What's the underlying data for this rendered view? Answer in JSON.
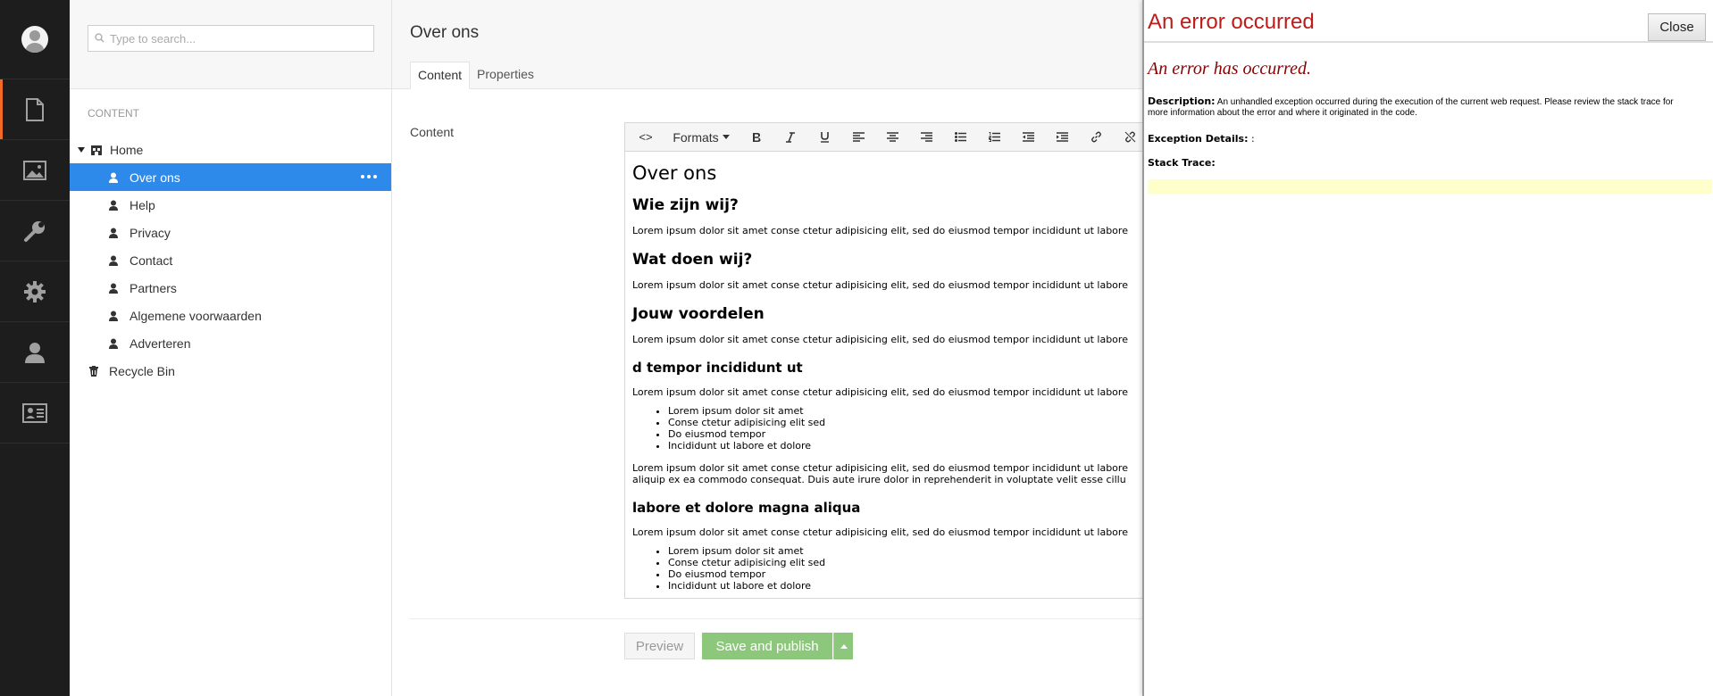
{
  "search": {
    "placeholder": "Type to search..."
  },
  "tree": {
    "section_label": "CONTENT",
    "root": "Home",
    "children": [
      "Over ons",
      "Help",
      "Privacy",
      "Contact",
      "Partners",
      "Algemene voorwaarden",
      "Adverteren"
    ],
    "recycle_bin": "Recycle Bin"
  },
  "editor": {
    "page_title": "Over ons",
    "tabs": [
      "Content",
      "Properties"
    ],
    "property_label": "Content",
    "toolbar": {
      "source": "<>",
      "formats": "Formats"
    },
    "content": {
      "h1": "Over ons",
      "h2_1": "Wie zijn wij?",
      "p1": "Lorem ipsum dolor sit amet conse ctetur adipisicing elit, sed do eiusmod tempor incididunt ut labore",
      "h2_2": "Wat doen wij?",
      "p2": "Lorem ipsum dolor sit amet conse ctetur adipisicing elit, sed do eiusmod tempor incididunt ut labore",
      "h2_3": "Jouw voordelen",
      "p3": "Lorem ipsum dolor sit amet conse ctetur adipisicing elit, sed do eiusmod tempor incididunt ut labore",
      "h3_1": "d tempor incididunt ut",
      "p4": "Lorem ipsum dolor sit amet conse ctetur adipisicing elit, sed do eiusmod tempor incididunt ut labore",
      "list1": [
        "Lorem ipsum dolor sit amet",
        "Conse ctetur adipisicing elit sed",
        "Do eiusmod tempor",
        "Incididunt ut labore et dolore"
      ],
      "p5_line1": "Lorem ipsum dolor sit amet conse ctetur adipisicing elit, sed do eiusmod tempor incididunt ut labore",
      "p5_line2": "aliquip ex ea commodo consequat. Duis aute irure dolor in reprehenderit in voluptate velit esse cillu",
      "h3_2": "labore et dolore magna aliqua",
      "p6": "Lorem ipsum dolor sit amet conse ctetur adipisicing elit, sed do eiusmod tempor incididunt ut labore",
      "list2": [
        "Lorem ipsum dolor sit amet",
        "Conse ctetur adipisicing elit sed",
        "Do eiusmod tempor",
        "Incididunt ut labore et dolore"
      ]
    },
    "buttons": {
      "preview": "Preview",
      "save": "Save and publish"
    }
  },
  "error": {
    "title": "An error occurred",
    "close": "Close",
    "subtitle": "An error has occurred.",
    "description_label": "Description:",
    "description_text": "An unhandled exception occurred during the execution of the current web request. Please review the stack trace for more information about the error and where it originated in the code.",
    "exception_label": "Exception Details:",
    "exception_value": ":",
    "stack_label": "Stack Trace:"
  },
  "colors": {
    "accent": "#f26a23",
    "selected": "#2e8aea",
    "save": "#8dc77c",
    "error_title": "#c01b1b",
    "error_subtitle": "#8b0000",
    "trace_bg": "#ffffcc"
  },
  "icons": [
    "avatar",
    "content-icon",
    "media-icon",
    "wrench-icon",
    "gear-icon",
    "user-icon",
    "member-card-icon",
    "search-icon",
    "home-icon",
    "page-person-icon",
    "recycle-bin-icon",
    "more-icon"
  ]
}
